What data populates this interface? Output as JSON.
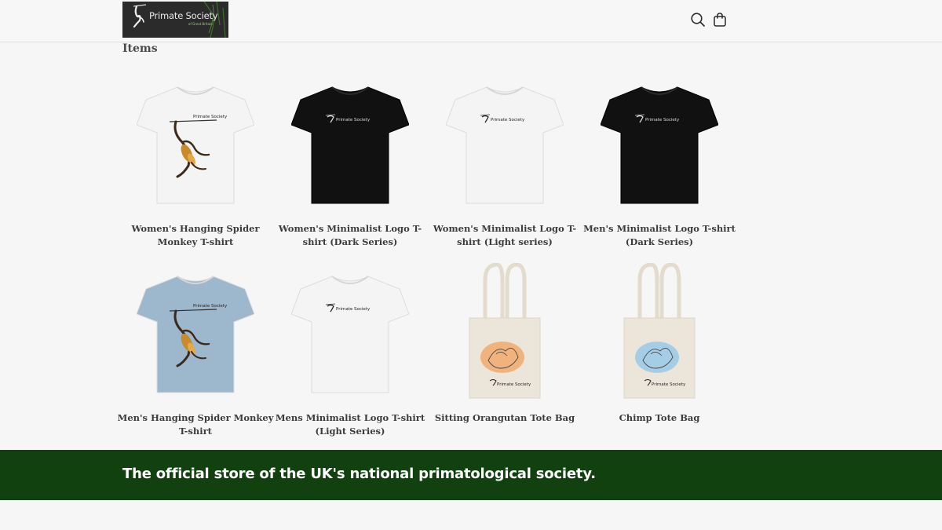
{
  "header": {
    "logo": {
      "name": "Primate Society",
      "sub": "of Great Britain"
    },
    "search_icon": "search-icon",
    "cart_icon": "shopping-bag-icon"
  },
  "main": {
    "section_title": "Items",
    "products": [
      {
        "name": "Women's Hanging Spider Monkey T-shirt",
        "image": "white-tshirt-monkey-print"
      },
      {
        "name": "Women's Minimalist Logo T-shirt (Dark Series)",
        "image": "black-tshirt-logo"
      },
      {
        "name": "Women's Minimalist Logo T-shirt (Light series)",
        "image": "white-tshirt-logo"
      },
      {
        "name": "Men's Minimalist Logo T-shirt (Dark Series)",
        "image": "black-tshirt-logo"
      },
      {
        "name": "Men's Hanging Spider Monkey T-shirt",
        "image": "blue-tshirt-monkey-print"
      },
      {
        "name": "Mens Minimalist Logo T-shirt (Light Series)",
        "image": "white-tshirt-logo"
      },
      {
        "name": "Sitting Orangutan Tote Bag",
        "image": "tote-bag-orange-print"
      },
      {
        "name": "Chimp Tote Bag",
        "image": "tote-bag-blue-print"
      }
    ]
  },
  "banner": {
    "text": "The official store of the UK's national primatological society."
  },
  "colors": {
    "banner_bg": "#124110",
    "page_bg": "#f6f6f6",
    "tshirt_black": "#111111",
    "tshirt_white": "#f4f4f4",
    "tshirt_blue": "#9db7cd",
    "tote": "#ece6da"
  }
}
